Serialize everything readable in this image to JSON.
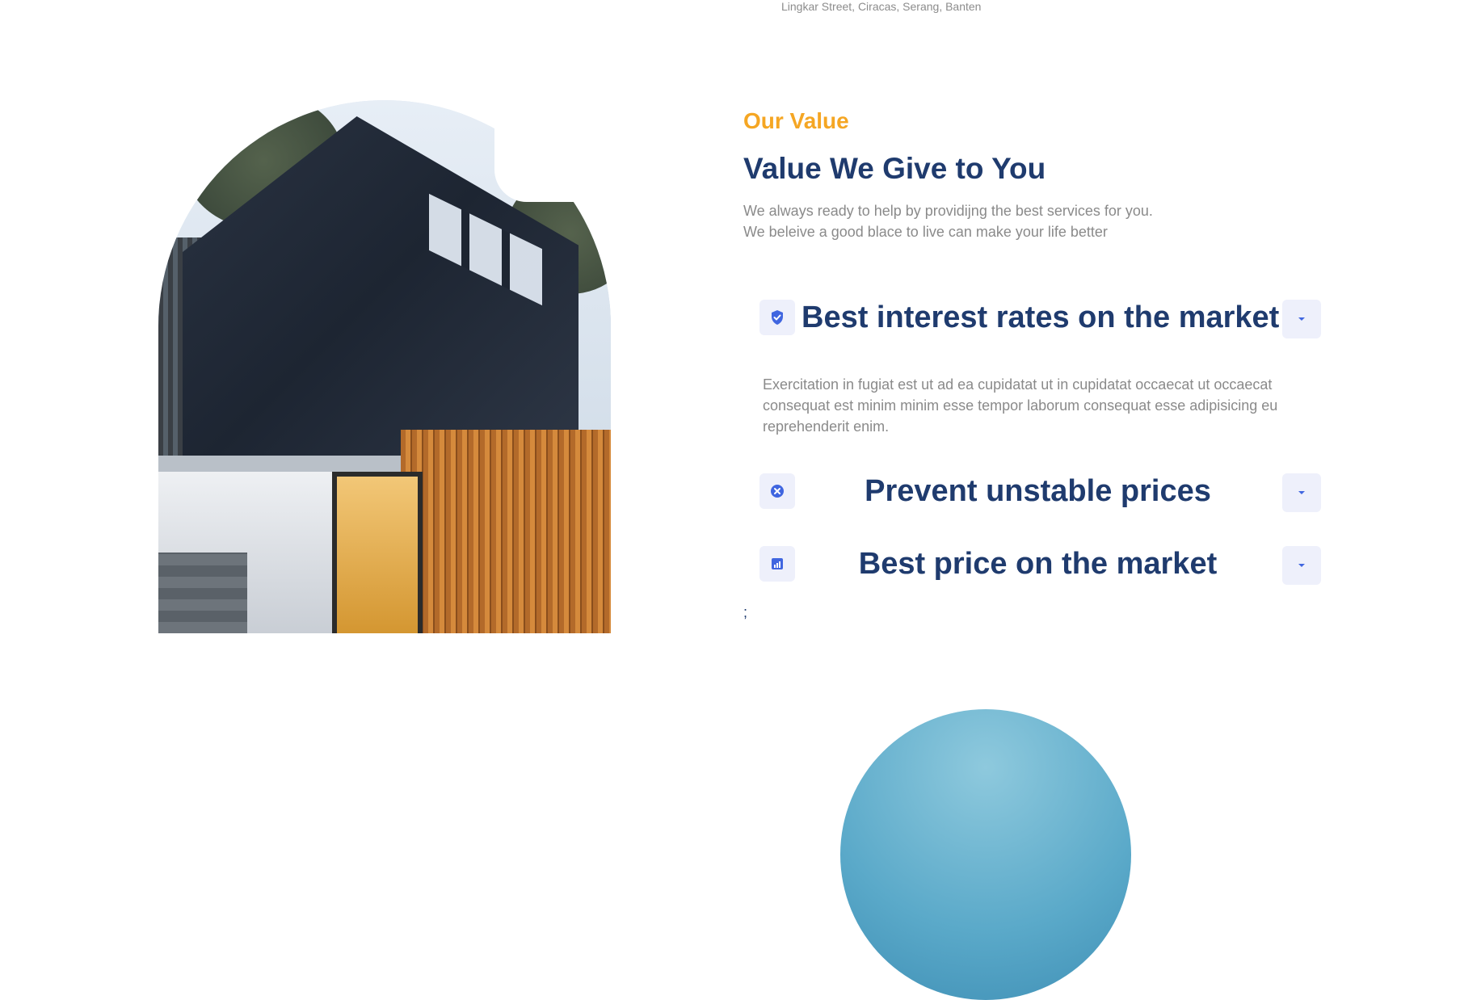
{
  "header": {
    "address": "Lingkar Street, Ciracas, Serang, Banten"
  },
  "value_section": {
    "eyebrow": "Our Value",
    "title": "Value We Give to You",
    "description": [
      "We always ready to help by providijng the best services for you.",
      "We beleive a good blace to live can make your life better"
    ],
    "accordion": [
      {
        "icon": "shield-check-icon",
        "title": "Best interest rates on the market",
        "expanded": true,
        "body": "Exercitation in fugiat est ut ad ea cupidatat ut in cupidatat occaecat ut occaecat consequat est minim minim esse tempor laborum consequat esse adipisicing eu reprehenderit enim."
      },
      {
        "icon": "close-circle-icon",
        "title": "Prevent unstable prices",
        "expanded": false
      },
      {
        "icon": "analytics-icon",
        "title": "Best price on the market",
        "expanded": false
      }
    ],
    "stray_text": ";"
  },
  "colors": {
    "accent": "#f5a623",
    "heading": "#1f3b6e",
    "icon": "#4066e0",
    "icon_bg": "#eef0fb"
  }
}
